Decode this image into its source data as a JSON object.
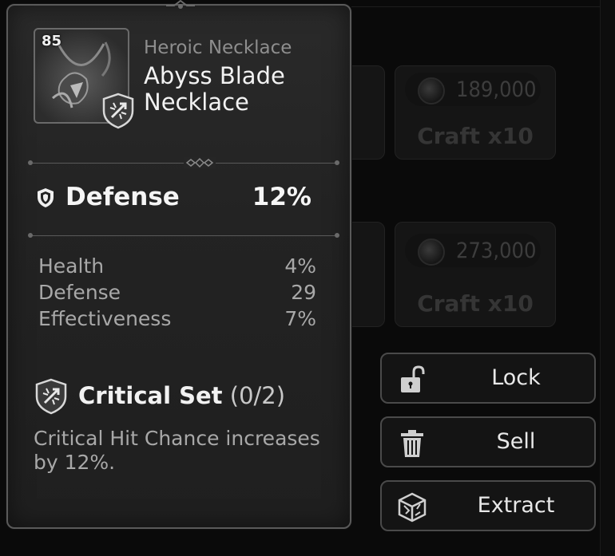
{
  "item": {
    "level": "85",
    "rarity": "Heroic Necklace",
    "name": "Abyss Blade Necklace"
  },
  "main_stat": {
    "name": "Defense",
    "value": "12%"
  },
  "substats": [
    {
      "name": "Health",
      "value": "4%"
    },
    {
      "name": "Defense",
      "value": "29"
    },
    {
      "name": "Effectiveness",
      "value": "7%"
    }
  ],
  "set": {
    "name": "Critical Set",
    "progress": "(0/2)",
    "description": "Critical Hit Chance increases by 12%."
  },
  "actions": {
    "lock": "Lock",
    "sell": "Sell",
    "extract": "Extract"
  },
  "background_craft": [
    {
      "amount": "189,000",
      "label": "Craft x10"
    },
    {
      "amount": "273,000",
      "label": "Craft x10"
    }
  ],
  "icons": {
    "shield": "shield-icon",
    "set_badge": "critical-set-icon",
    "lock": "unlocked-padlock-icon",
    "sell": "trash-can-icon",
    "extract": "broken-cube-icon"
  },
  "colors": {
    "panel_border": "#5a5a5a",
    "text_primary": "#f2f2f2",
    "text_secondary": "#a8a8a8"
  }
}
